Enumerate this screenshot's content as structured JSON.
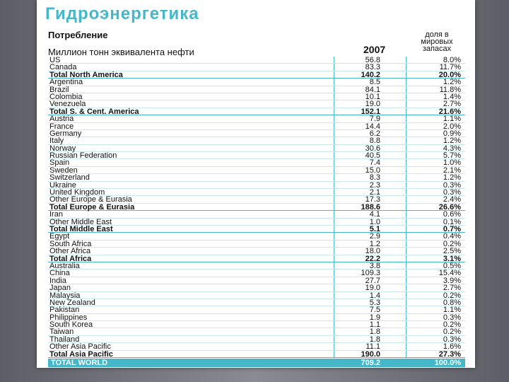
{
  "title": "Гидроэнергетика",
  "header": {
    "consumption": "Потребление",
    "unit": "Миллион тонн эквивалента нефти",
    "year": "2007",
    "share": "доля в мировых запасах"
  },
  "rows": [
    {
      "name": "US",
      "value": "56.8",
      "share": "8.0%",
      "total": false
    },
    {
      "name": "Canada",
      "value": "83.3",
      "share": "11.7%",
      "total": false
    },
    {
      "name": "Total North America",
      "value": "140.2",
      "share": "20.0%",
      "total": true
    },
    {
      "name": "Argentina",
      "value": "8.5",
      "share": "1.2%",
      "total": false
    },
    {
      "name": "Brazil",
      "value": "84.1",
      "share": "11.8%",
      "total": false
    },
    {
      "name": "Colombia",
      "value": "10.1",
      "share": "1.4%",
      "total": false
    },
    {
      "name": "Venezuela",
      "value": "19.0",
      "share": "2.7%",
      "total": false
    },
    {
      "name": "Total S. & Cent. America",
      "value": "152.1",
      "share": "21.6%",
      "total": true
    },
    {
      "name": "Austria",
      "value": "7.9",
      "share": "1.1%",
      "total": false
    },
    {
      "name": "France",
      "value": "14.4",
      "share": "2.0%",
      "total": false
    },
    {
      "name": "Germany",
      "value": "6.2",
      "share": "0.9%",
      "total": false
    },
    {
      "name": "Italy",
      "value": "8.8",
      "share": "1.2%",
      "total": false
    },
    {
      "name": "Norway",
      "value": "30.6",
      "share": "4.3%",
      "total": false
    },
    {
      "name": "Russian Federation",
      "value": "40.5",
      "share": "5.7%",
      "total": false
    },
    {
      "name": "Spain",
      "value": "7.4",
      "share": "1.0%",
      "total": false
    },
    {
      "name": "Sweden",
      "value": "15.0",
      "share": "2.1%",
      "total": false
    },
    {
      "name": "Switzerland",
      "value": "8.3",
      "share": "1.2%",
      "total": false
    },
    {
      "name": "Ukraine",
      "value": "2.3",
      "share": "0.3%",
      "total": false
    },
    {
      "name": "United Kingdom",
      "value": "2.1",
      "share": "0.3%",
      "total": false
    },
    {
      "name": "Other Europe & Eurasia",
      "value": "17.3",
      "share": "2.4%",
      "total": false
    },
    {
      "name": "Total Europe & Eurasia",
      "value": "188.6",
      "share": "26.6%",
      "total": true
    },
    {
      "name": "Iran",
      "value": "4.1",
      "share": "0.6%",
      "total": false
    },
    {
      "name": "Other Middle East",
      "value": "1.0",
      "share": "0.1%",
      "total": false
    },
    {
      "name": "Total Middle East",
      "value": "5.1",
      "share": "0.7%",
      "total": true
    },
    {
      "name": "Egypt",
      "value": "2.9",
      "share": "0.4%",
      "total": false
    },
    {
      "name": "South Africa",
      "value": "1.2",
      "share": "0.2%",
      "total": false
    },
    {
      "name": "Other Africa",
      "value": "18.0",
      "share": "2.5%",
      "total": false
    },
    {
      "name": "Total Africa",
      "value": "22.2",
      "share": "3.1%",
      "total": true
    },
    {
      "name": "Australia",
      "value": "3.8",
      "share": "0.5%",
      "total": false
    },
    {
      "name": "China",
      "value": "109.3",
      "share": "15.4%",
      "total": false
    },
    {
      "name": "India",
      "value": "27.7",
      "share": "3.9%",
      "total": false
    },
    {
      "name": "Japan",
      "value": "19.0",
      "share": "2.7%",
      "total": false
    },
    {
      "name": "Malaysia",
      "value": "1.4",
      "share": "0.2%",
      "total": false
    },
    {
      "name": "New Zealand",
      "value": "5.3",
      "share": "0.8%",
      "total": false
    },
    {
      "name": "Pakistan",
      "value": "7.5",
      "share": "1.1%",
      "total": false
    },
    {
      "name": "Philippines",
      "value": "1.9",
      "share": "0.3%",
      "total": false
    },
    {
      "name": "South Korea",
      "value": "1.1",
      "share": "0.2%",
      "total": false
    },
    {
      "name": "Taiwan",
      "value": "1.8",
      "share": "0.2%",
      "total": false
    },
    {
      "name": "Thailand",
      "value": "1.8",
      "share": "0.3%",
      "total": false
    },
    {
      "name": "Other Asia Pacific",
      "value": "11.1",
      "share": "1.6%",
      "total": false
    },
    {
      "name": "Total Asia Pacific",
      "value": "190.0",
      "share": "27.3%",
      "total": true
    }
  ],
  "world": {
    "name": "TOTAL WORLD",
    "value": "709.2",
    "share": "100.0%"
  },
  "colors": {
    "accent": "#45b7c9",
    "text": "#111111",
    "background": "#ffffff"
  }
}
